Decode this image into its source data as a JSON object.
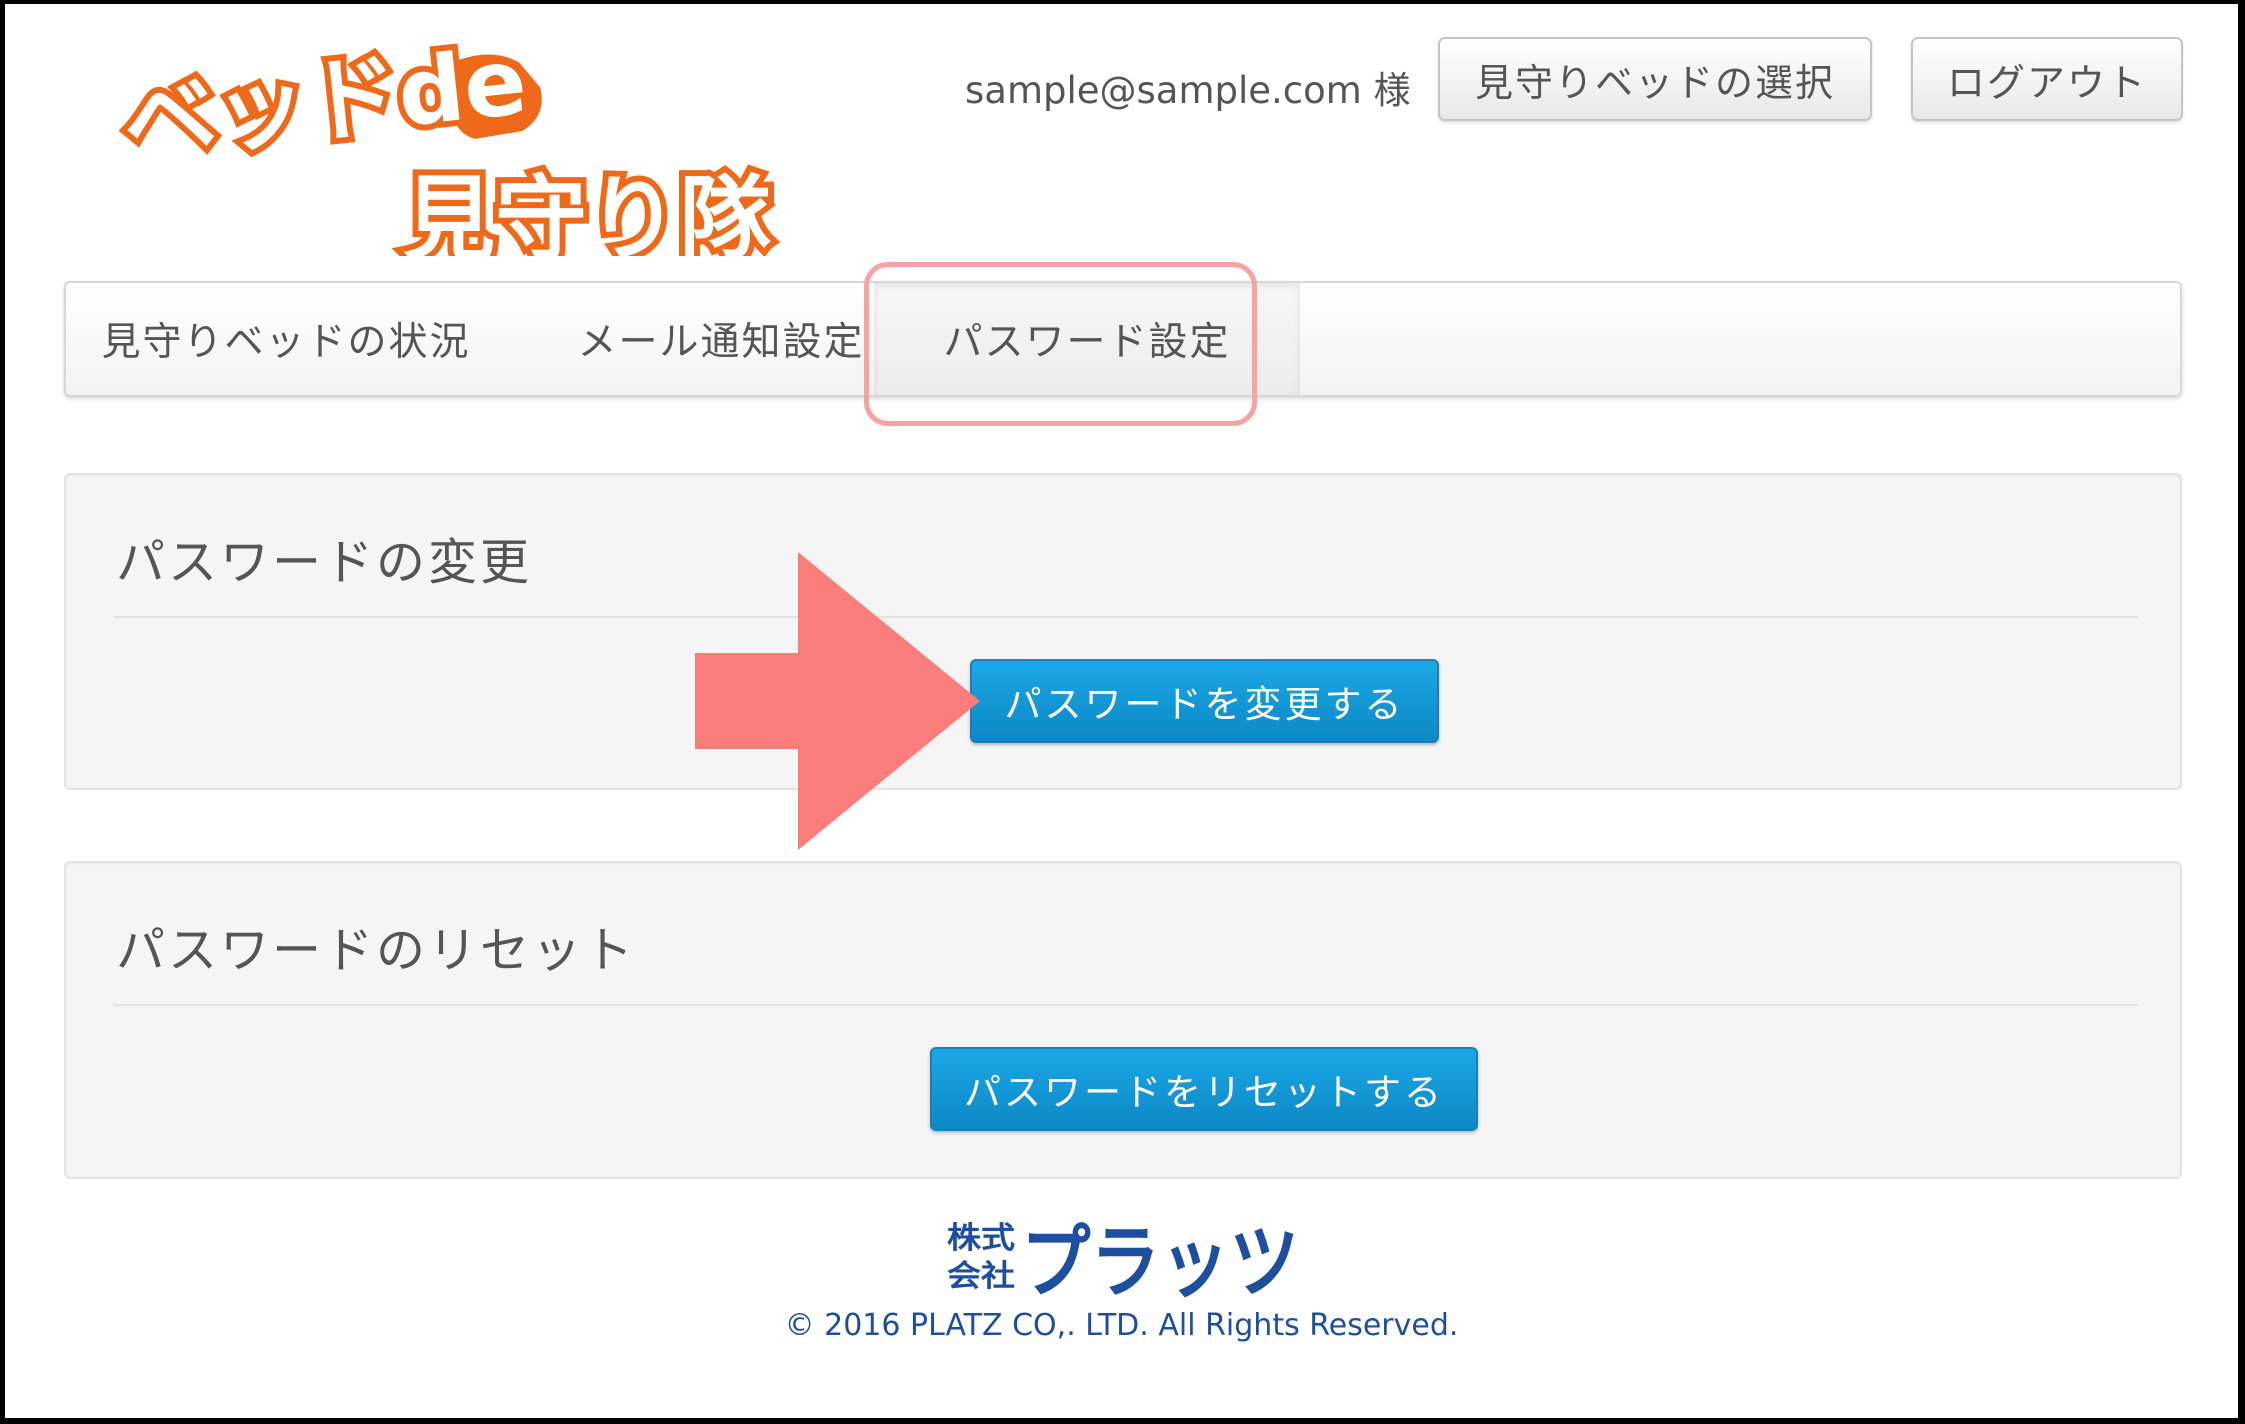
{
  "header": {
    "logo_text_line1": "ベッドde",
    "logo_text_line2": "見守り隊",
    "user_label": "sample@sample.com 様",
    "select_bed_label": "見守りベッドの選択",
    "logout_label": "ログアウト"
  },
  "nav": {
    "items": [
      {
        "label": "見守りベッドの状況"
      },
      {
        "label": "メール通知設定"
      },
      {
        "label": "パスワード設定",
        "active": true
      }
    ]
  },
  "panels": {
    "change": {
      "title": "パスワードの変更",
      "button_label": "パスワードを変更する"
    },
    "reset": {
      "title": "パスワードのリセット",
      "button_label": "パスワードをリセットする"
    }
  },
  "footer": {
    "company_logo_small": "株式会社",
    "company_logo_main": "プラッツ",
    "copyright": "© 2016 PLATZ CO,. LTD. All Rights Reserved."
  },
  "colors": {
    "logo_orange": "#ee6a1a",
    "primary_blue": "#1597d5",
    "annotation_pink": "#f87d7b",
    "highlight_pink": "#f7a3a3",
    "footer_blue": "#1d4f9e"
  }
}
